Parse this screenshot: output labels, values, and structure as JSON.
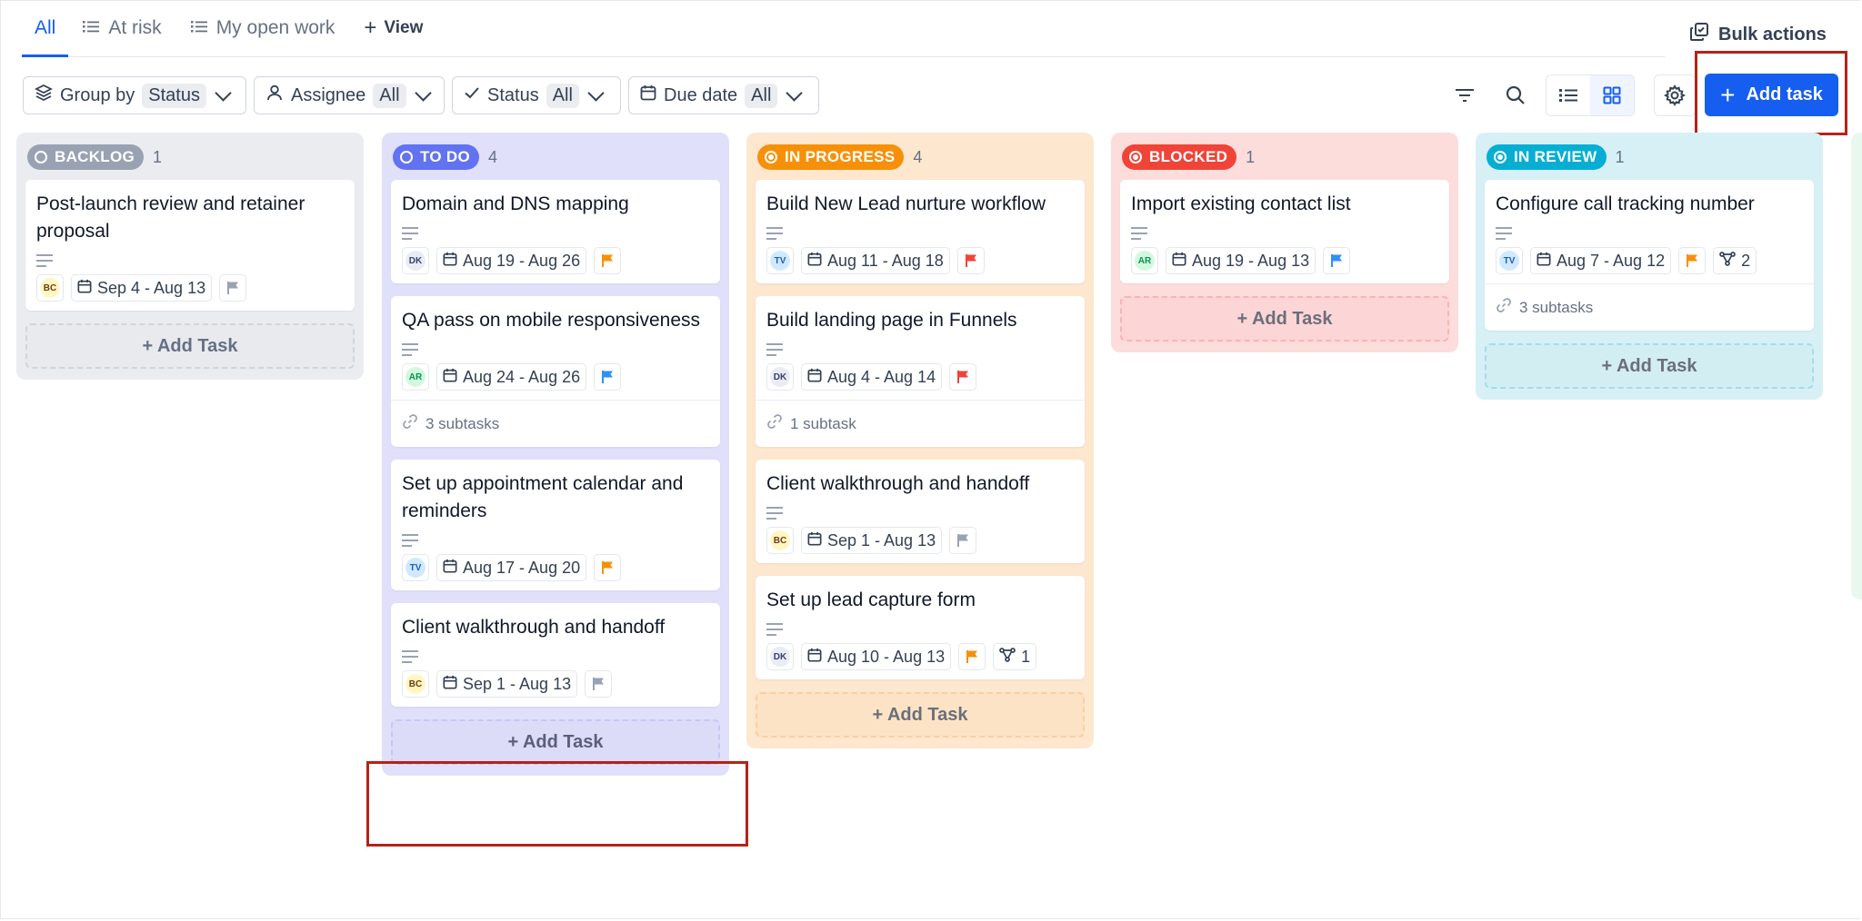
{
  "tabs": [
    {
      "label": "All",
      "icon": "none",
      "active": true
    },
    {
      "label": "At risk",
      "icon": "list-icon"
    },
    {
      "label": "My open work",
      "icon": "list-icon"
    }
  ],
  "view_label": "View",
  "bulk_actions_label": "Bulk actions",
  "filters": {
    "group_by": {
      "label": "Group by",
      "value": "Status"
    },
    "assignee": {
      "label": "Assignee",
      "value": "All"
    },
    "status": {
      "label": "Status",
      "value": "All"
    },
    "due_date": {
      "label": "Due date",
      "value": "All"
    }
  },
  "add_task_label": "Add task",
  "add_task_row_label": "+ Add Task",
  "colors": {
    "accent": "#155eef",
    "backlog": "#98a2b3",
    "todo": "#6172f3",
    "in_progress": "#f79009",
    "blocked": "#f04438",
    "in_review": "#06aed4",
    "flag_orange": "#f79009",
    "flag_red": "#f04438",
    "flag_blue": "#2e90fa",
    "flag_gray": "#98a2b3"
  },
  "columns": [
    {
      "name": "BACKLOG",
      "count": "1",
      "cards": [
        {
          "title": "Post-launch review and retainer proposal",
          "assignee": "BC",
          "dates": "Sep 4 - Aug 13",
          "flag": "gray",
          "subtasks": ""
        }
      ]
    },
    {
      "name": "TO DO",
      "count": "4",
      "cards": [
        {
          "title": "Domain and DNS mapping",
          "assignee": "DK",
          "dates": "Aug 19 - Aug 26",
          "flag": "orange",
          "subtasks": ""
        },
        {
          "title": "QA pass on mobile responsiveness",
          "assignee": "AR",
          "dates": "Aug 24 - Aug 26",
          "flag": "blue",
          "subtasks": "3 subtasks"
        },
        {
          "title": "Set up appointment calendar and reminders",
          "assignee": "TV",
          "dates": "Aug 17 - Aug 20",
          "flag": "orange",
          "subtasks": ""
        },
        {
          "title": "Client walkthrough and handoff",
          "assignee": "BC",
          "dates": "Sep 1 - Aug 13",
          "flag": "gray",
          "subtasks": ""
        }
      ]
    },
    {
      "name": "IN PROGRESS",
      "count": "4",
      "cards": [
        {
          "title": "Build New Lead nurture workflow",
          "assignee": "TV",
          "dates": "Aug 11 - Aug 18",
          "flag": "red",
          "subtasks": ""
        },
        {
          "title": "Build landing page in Funnels",
          "assignee": "DK",
          "dates": "Aug 4 - Aug 14",
          "flag": "red",
          "subtasks": "1 subtask"
        },
        {
          "title": "Client walkthrough and handoff",
          "assignee": "BC",
          "dates": "Sep 1 - Aug 13",
          "flag": "gray",
          "subtasks": ""
        },
        {
          "title": "Set up lead capture form",
          "assignee": "DK",
          "dates": "Aug 10 - Aug 13",
          "flag": "orange",
          "deps": "1",
          "subtasks": ""
        }
      ]
    },
    {
      "name": "BLOCKED",
      "count": "1",
      "cards": [
        {
          "title": "Import existing contact list",
          "assignee": "AR",
          "dates": "Aug 19 - Aug 13",
          "flag": "blue",
          "subtasks": ""
        }
      ]
    },
    {
      "name": "IN REVIEW",
      "count": "1",
      "cards": [
        {
          "title": "Configure call tracking number",
          "assignee": "TV",
          "dates": "Aug 7 - Aug 12",
          "flag": "orange",
          "deps": "2",
          "subtasks": "3 subtasks"
        }
      ]
    }
  ]
}
